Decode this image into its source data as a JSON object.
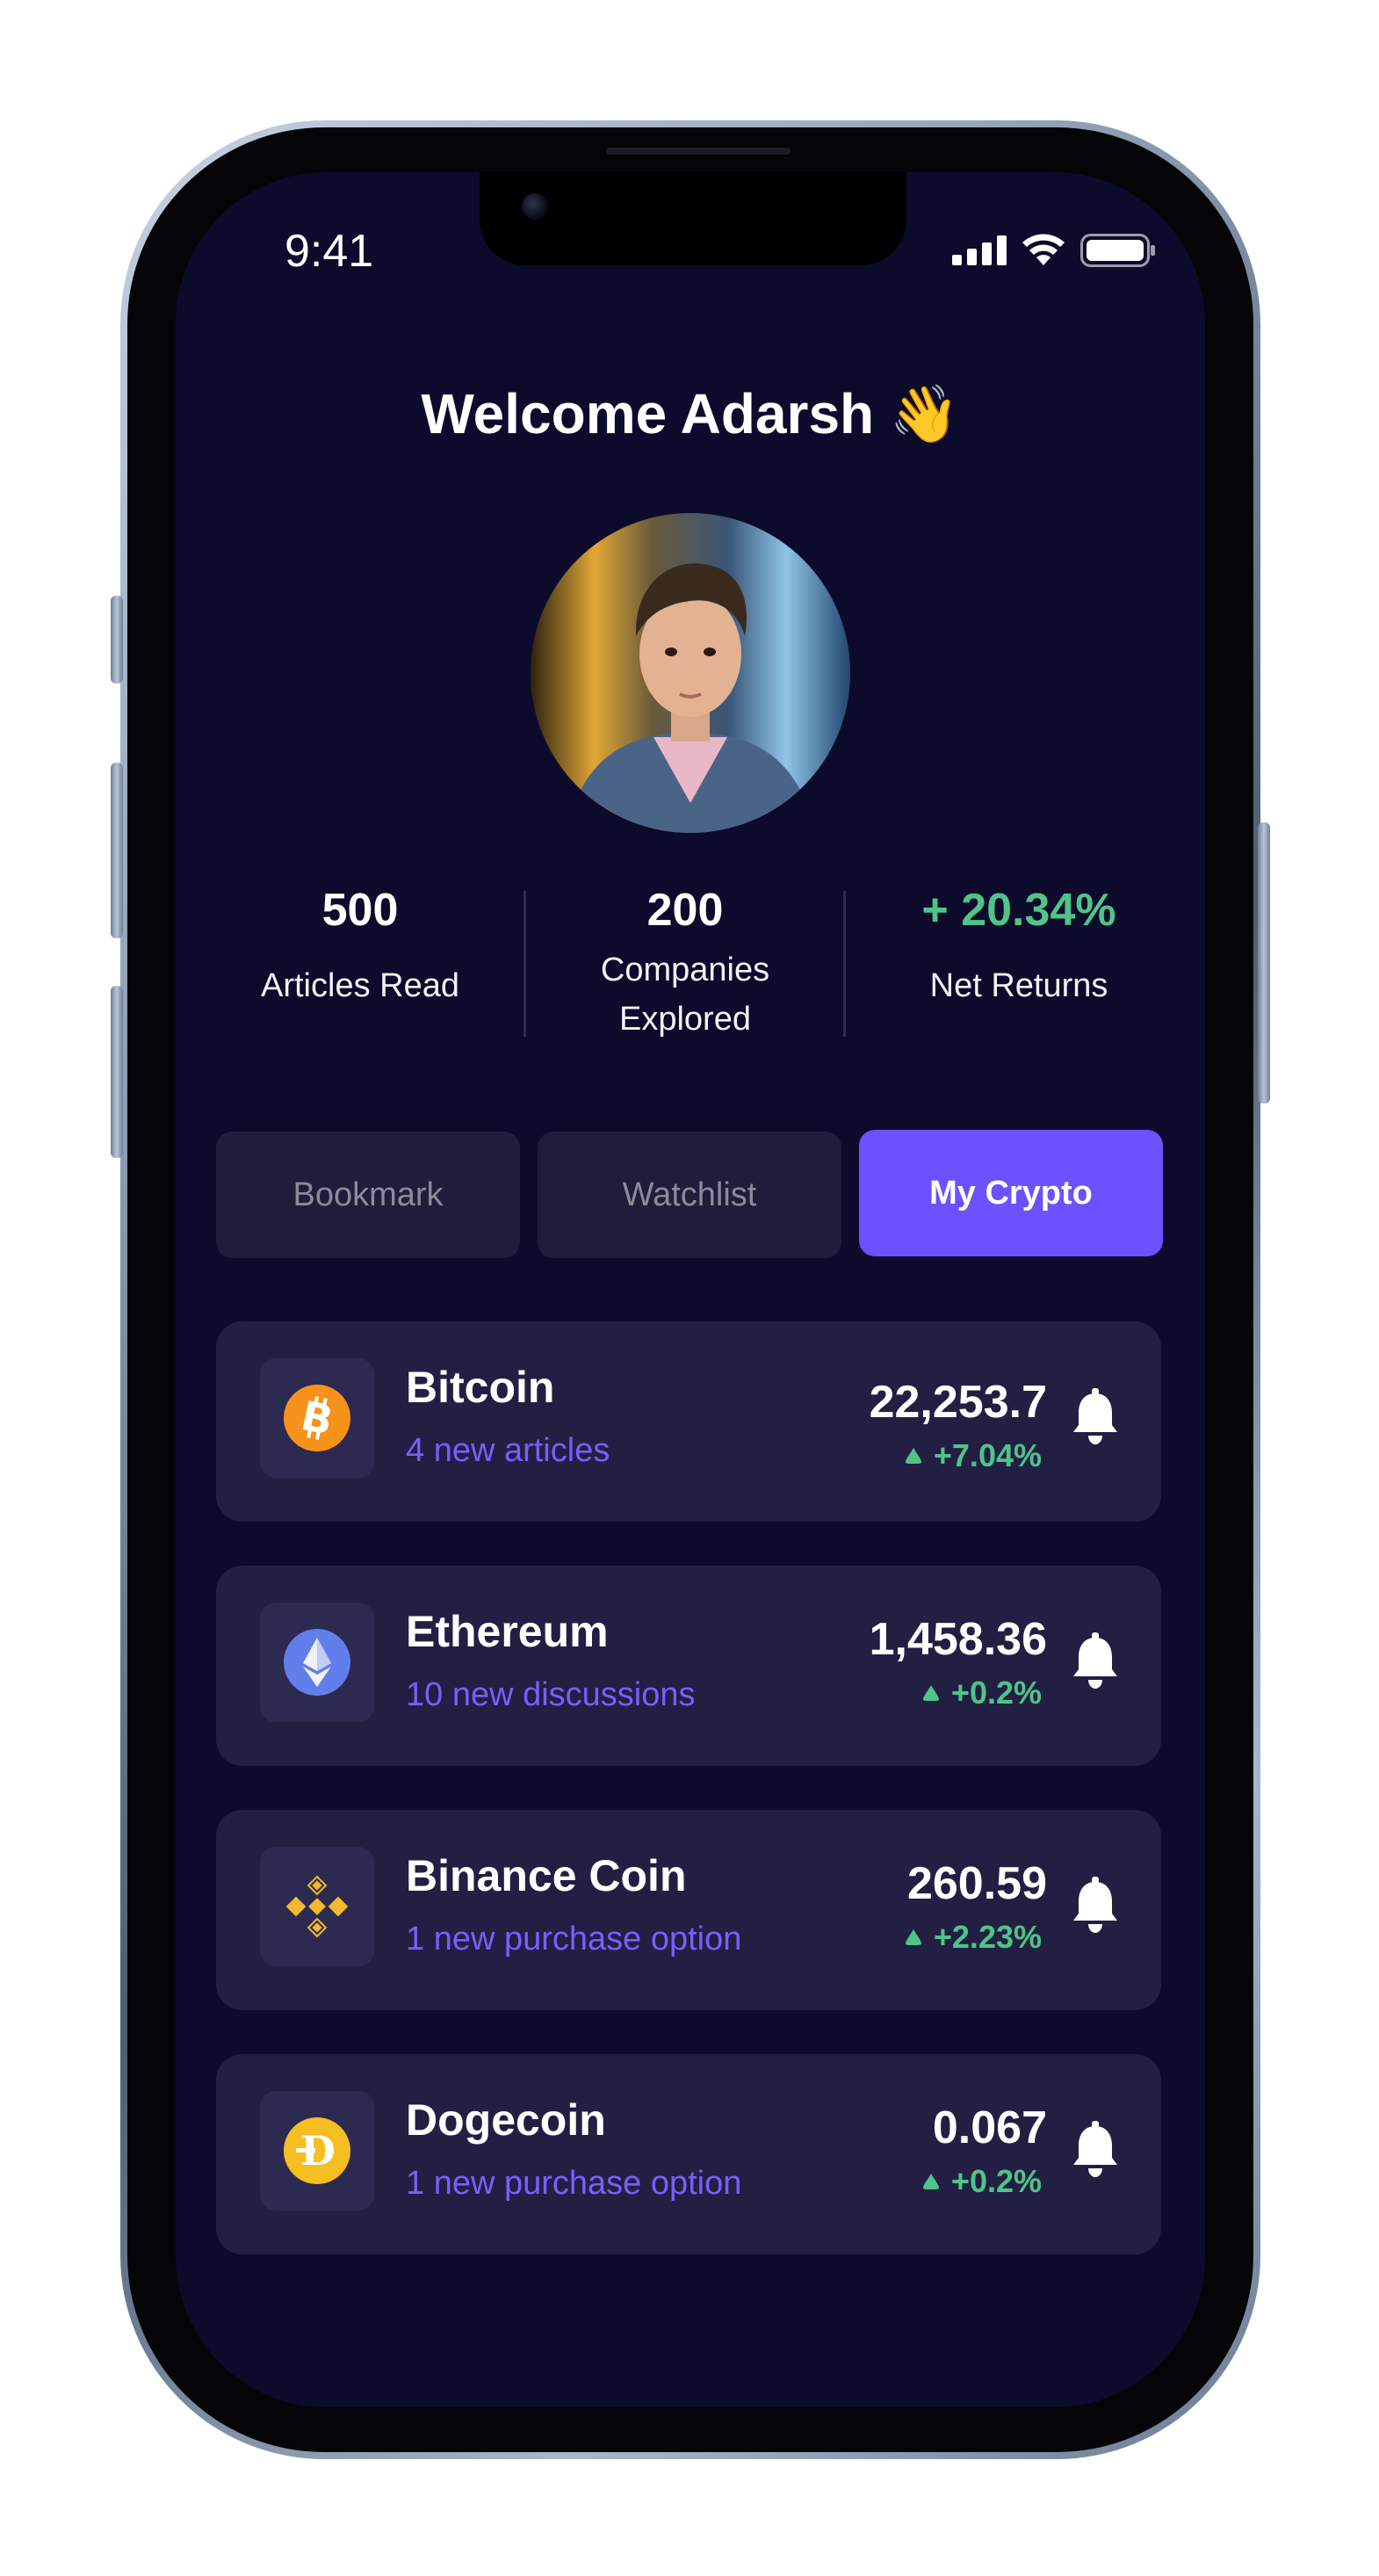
{
  "status_bar": {
    "time": "9:41"
  },
  "header": {
    "welcome": "Welcome Adarsh 👋"
  },
  "stats": [
    {
      "value": "500",
      "label": "Articles Read"
    },
    {
      "value": "200",
      "label": "Companies Explored"
    },
    {
      "value": "+ 20.34%",
      "label": "Net Returns"
    }
  ],
  "tabs": [
    {
      "label": "Bookmark",
      "active": false
    },
    {
      "label": "Watchlist",
      "active": false
    },
    {
      "label": "My Crypto",
      "active": true
    }
  ],
  "coins": [
    {
      "name": "Bitcoin",
      "subtitle": "4 new articles",
      "price": "22,253.7",
      "change": "+7.04%",
      "icon": "bitcoin-icon"
    },
    {
      "name": "Ethereum",
      "subtitle": "10 new discussions",
      "price": "1,458.36",
      "change": "+0.2%",
      "icon": "ethereum-icon"
    },
    {
      "name": "Binance Coin",
      "subtitle": "1 new purchase option",
      "price": "260.59",
      "change": "+2.23%",
      "icon": "binance-icon"
    },
    {
      "name": "Dogecoin",
      "subtitle": "1 new purchase option",
      "price": "0.067",
      "change": "+0.2%",
      "icon": "dogecoin-icon"
    }
  ],
  "colors": {
    "background": "#0d0b2c",
    "card": "#221f43",
    "accent": "#6c51ff",
    "positive": "#4fc488",
    "subtitle": "#7b5dff"
  }
}
